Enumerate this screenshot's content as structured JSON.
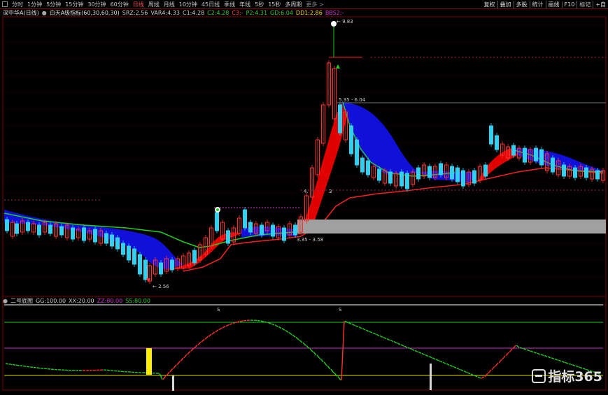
{
  "toolbar": {
    "timeframes": [
      "分时",
      "1分钟",
      "5分钟",
      "15分钟",
      "30分钟",
      "60分钟",
      "日线",
      "周线",
      "月线",
      "10分钟",
      "45日线",
      "季线",
      "年线",
      "5秒",
      "15秒",
      "多周期",
      "更多 >"
    ],
    "active_timeframe": "日线",
    "right_tools": [
      "复权",
      "叠加",
      "多股",
      "统计",
      "画线",
      "F10",
      "标记",
      "+自"
    ]
  },
  "info": {
    "stock": "深中华A(日线)",
    "indicator": "白天A级指标(60,30,60,30)",
    "values": [
      {
        "label": "SRZ:",
        "value": "2.56",
        "color": "#cccccc"
      },
      {
        "label": "VAR4:",
        "value": "4.33",
        "color": "#cccccc"
      },
      {
        "label": "C1:",
        "value": "4.28",
        "color": "#cccccc"
      },
      {
        "label": "C2:",
        "value": "4.28",
        "color": "#33cc33"
      },
      {
        "label": "C3:",
        "value": "-",
        "color": "#ff4040"
      },
      {
        "label": "P2:",
        "value": "4.31",
        "color": "#33cc33"
      },
      {
        "label": "GD:",
        "value": "6.04",
        "color": "#33cc33"
      },
      {
        "label": "DD1:",
        "value": "2.86",
        "color": "#ffdd00"
      },
      {
        "label": "BBS2:",
        "value": "-",
        "color": "#cc33cc"
      }
    ]
  },
  "price_annotations": {
    "high_label": "9.83",
    "low_label": "2.56",
    "upper_range_label": "5.35 - 6.04",
    "lower_range_label": "3.35 - 3.58",
    "mid_label_left": "4.",
    "mid_label_right": "3"
  },
  "indicator_panel": {
    "name": "二号底图",
    "params": [
      {
        "label": "GG:",
        "value": "100.00",
        "color": "#cccccc"
      },
      {
        "label": "XX:",
        "value": "20.00",
        "color": "#cccccc"
      },
      {
        "label": "ZZ:",
        "value": "80.00",
        "color": "#cc33cc"
      },
      {
        "label": "SS:",
        "value": "80.00",
        "color": "#33cc33"
      }
    ],
    "signal_marks": [
      "S",
      "S"
    ]
  },
  "colors": {
    "up_candle": "#ff3030",
    "down_candle": "#30d0f0",
    "band_red": "#e00000",
    "band_blue": "#1010d8",
    "ma_green": "#22cc22",
    "ma_red": "#ee2222",
    "grid": "#7a0000"
  },
  "watermark": {
    "text": "指标365",
    "icon": "brand-logo-icon"
  }
}
